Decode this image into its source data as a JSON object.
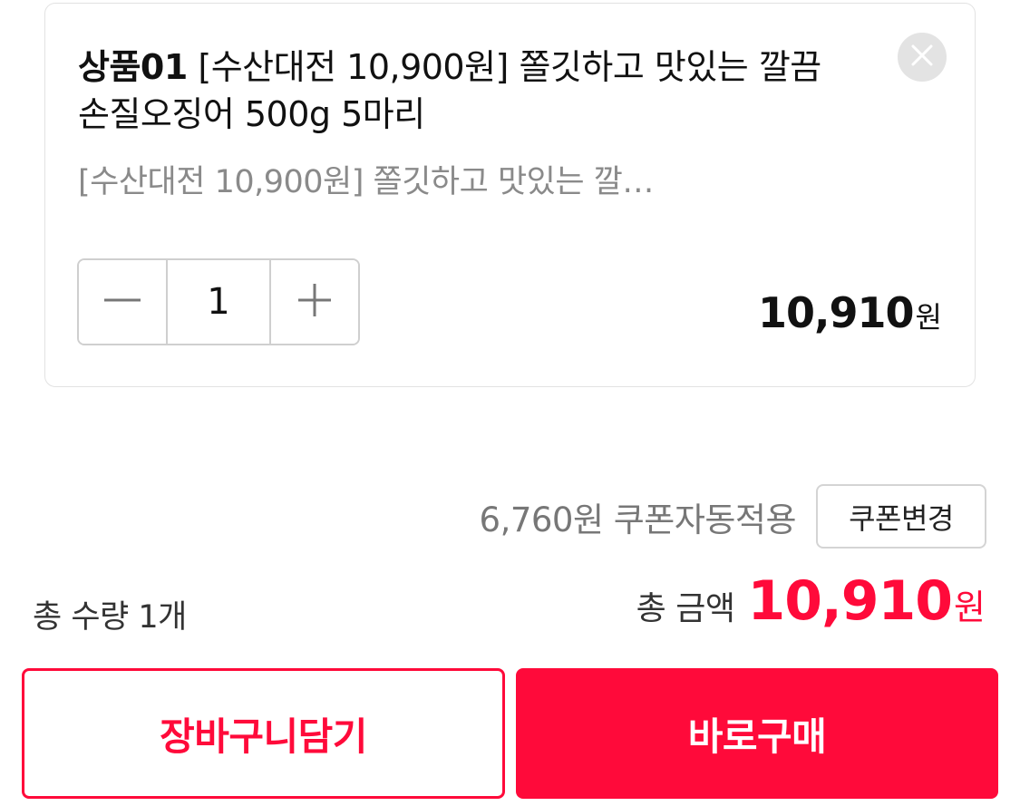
{
  "product": {
    "code": "상품01",
    "title": " [수산대전 10,900원] 쫄깃하고 맛있는 깔끔 손질오징어 500g 5마리",
    "option_text": "[수산대전 10,900원] 쫄깃하고 맛있는 깔…",
    "quantity": "1",
    "price": "10,910",
    "price_unit": "원",
    "close_icon": "close-icon",
    "minus_icon": "minus-icon",
    "plus_icon": "plus-icon"
  },
  "coupon": {
    "text": "6,760원 쿠폰자동적용",
    "change_label": "쿠폰변경"
  },
  "summary": {
    "total_qty_text": "총 수량 1개",
    "total_label": "총 금액",
    "total_price": "10,910",
    "total_unit": "원"
  },
  "actions": {
    "cart_label": "장바구니담기",
    "buy_label": "바로구매"
  },
  "colors": {
    "accent": "#ff0a3a",
    "close_bg": "#e3e3e3",
    "border": "#cfcfcf"
  }
}
